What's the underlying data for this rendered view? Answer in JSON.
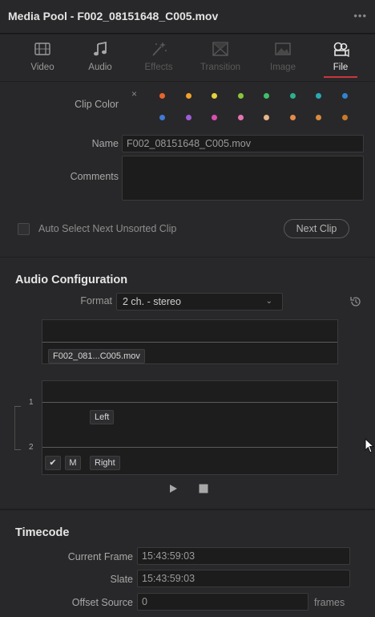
{
  "window": {
    "title": "Media Pool - F002_08151648_C005.mov",
    "more_label": "•••"
  },
  "tabs": [
    {
      "label": "Video",
      "icon": "film-icon",
      "state": "normal"
    },
    {
      "label": "Audio",
      "icon": "music-note-icon",
      "state": "normal"
    },
    {
      "label": "Effects",
      "icon": "magic-wand-icon",
      "state": "disabled"
    },
    {
      "label": "Transition",
      "icon": "transition-icon",
      "state": "disabled"
    },
    {
      "label": "Image",
      "icon": "image-icon",
      "state": "disabled"
    },
    {
      "label": "File",
      "icon": "file-reels-icon",
      "state": "active"
    }
  ],
  "clip": {
    "clip_color_label": "Clip Color",
    "clear_color": "×",
    "color_swatches": [
      "#e8652a",
      "#f0a22a",
      "#e6d23a",
      "#8cc43c",
      "#3fbf6a",
      "#2bb08f",
      "#2aa9b5",
      "#2f84d0",
      "#3f7ad8",
      "#9b5ed6",
      "#d94fb0",
      "#e674b0",
      "#e7b58a",
      "#e88a4a",
      "#d98a3a",
      "#c97a2a"
    ],
    "name_label": "Name",
    "name_value": "F002_08151648_C005.mov",
    "comments_label": "Comments",
    "comments_value": "",
    "auto_select_label": "Auto Select Next Unsorted Clip",
    "next_clip_label": "Next Clip"
  },
  "audio": {
    "heading": "Audio Configuration",
    "format_label": "Format",
    "format_value": "2 ch. - stereo",
    "chevron": "⌄",
    "source_clip_label": "F002_081...C005.mov",
    "channel_1_number": "1",
    "channel_2_number": "2",
    "channel_1_label": "Left",
    "channel_2_label": "Right",
    "checkmark": "✔",
    "mute_label": "M"
  },
  "timecode": {
    "heading": "Timecode",
    "current_frame_label": "Current Frame",
    "current_frame_value": "15:43:59:03",
    "slate_label": "Slate",
    "slate_value": "15:43:59:03",
    "offset_source_label": "Offset Source",
    "offset_source_value": "0",
    "frames_label": "frames"
  },
  "colors": {
    "panel_bg": "#28282a",
    "window_bg": "#1e1e1f",
    "active_tab_underline": "#c9373c"
  }
}
